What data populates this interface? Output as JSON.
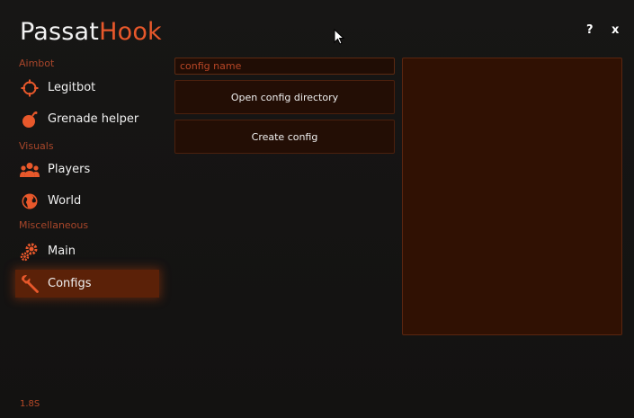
{
  "app": {
    "logo_white": "Passat",
    "logo_orange": "Hook",
    "help_label": "?",
    "close_label": "x",
    "version": "1.8S"
  },
  "sidebar": {
    "sections": [
      {
        "label": "Aimbot"
      },
      {
        "label": "Visuals"
      },
      {
        "label": "Miscellaneous"
      }
    ],
    "items": [
      {
        "label": "Legitbot",
        "icon": "crosshair-icon"
      },
      {
        "label": "Grenade helper",
        "icon": "grenade-icon"
      },
      {
        "label": "Players",
        "icon": "players-icon"
      },
      {
        "label": "World",
        "icon": "globe-icon"
      },
      {
        "label": "Main",
        "icon": "gears-icon"
      },
      {
        "label": "Configs",
        "icon": "wrench-icon",
        "active": true
      }
    ]
  },
  "main": {
    "config_name_placeholder": "config name",
    "open_dir_label": "Open config directory",
    "create_label": "Create config"
  },
  "colors": {
    "accent": "#e8582b",
    "section_label": "#a8462a",
    "active_item": "#5b2108",
    "panel": "#301103",
    "background": "#141312"
  }
}
